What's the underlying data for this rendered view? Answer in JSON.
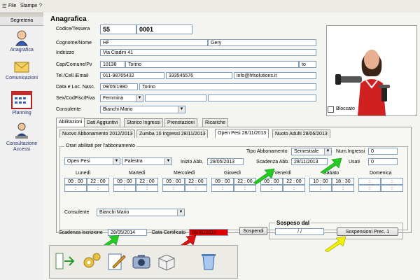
{
  "menu": {
    "file": "File",
    "stampe": "Stampe",
    "help": "?"
  },
  "sidebar": {
    "header": "Segreteria",
    "items": [
      {
        "label": "Anagrafica"
      },
      {
        "label": "Comunicazioni"
      },
      {
        "label": "Planning"
      },
      {
        "label": "Consultazione Accessi"
      }
    ]
  },
  "anagrafica": {
    "title": "Anagrafica",
    "codice_label": "Codice/Tessera",
    "codice": "55",
    "tessera": "0001",
    "cognome_label": "Cognome/Nome",
    "cognome": "HF",
    "nome": "Gery",
    "indirizzo_label": "Indirizzo",
    "indirizzo": "Via Ciadini 41",
    "cap_label": "Cap/Comune/Pv",
    "cap": "10138",
    "comune": "Torino",
    "pv": "to",
    "tel_label": "Tel./Cell./Email",
    "tel": "011-98765432",
    "cell": "333545576",
    "email": "info@hfsolutions.it",
    "nascita_label": "Data e Loc. Nasc.",
    "data_nascita": "09/05/1980",
    "loc_nascita": "Torino",
    "sesso_label": "Sex/CodFisc/Piva",
    "sesso": "Femmina",
    "consulente_label": "Consulente",
    "consulente": "Bianchi Mario",
    "bloccato_label": "Bloccato"
  },
  "tabs": [
    "Abilitazioni",
    "Dati Aggiuntivi",
    "Storico Ingressi",
    "Prenotazioni",
    "Ricariche"
  ],
  "subtabs": [
    "Nuovo Abbonamento 2012/2013",
    "Zumba 10 Ingressi 28/11/2013",
    "Open Pesi 28/11/2013",
    "Nuoto Adulti 28/06/2013"
  ],
  "abbonamento": {
    "group_title": "Orari abilitati per l'abbonamento",
    "nome": "Open Pesi",
    "area": "Palestra",
    "tipo_label": "Tipo Abbonamento",
    "tipo": "Semestrale",
    "num_ingressi_label": "Num.Ingressi",
    "num_ingressi": "0",
    "inizio_label": "Inizio Abb.",
    "inizio": "28/05/2013",
    "scadenza_label": "Scadenza Abb.",
    "scadenza": "28/11/2013",
    "usati_label": "Usati",
    "usati": "0",
    "consulente_label": "Consulente",
    "consulente": "Bianchi Mario"
  },
  "days": [
    {
      "name": "Lunedì",
      "from": "09 : 00",
      "to": "22 : 00"
    },
    {
      "name": "Martedì",
      "from": "09 : 00",
      "to": "22 : 00"
    },
    {
      "name": "Mercoledì",
      "from": "09 : 00",
      "to": "22 : 00"
    },
    {
      "name": "Giovedì",
      "from": "09 : 00",
      "to": "22 : 00"
    },
    {
      "name": "Venerdì",
      "from": "09 : 00",
      "to": "22 : 00"
    },
    {
      "name": "Sabato",
      "from": "10 : 00",
      "to": "18 : 30"
    },
    {
      "name": "Domenica",
      "from": ":",
      "to": ":"
    }
  ],
  "empty_time": ":",
  "bottom": {
    "scadenza_iscr_label": "Scadenza Iscrizione",
    "scadenza_iscr": "28/05/2014",
    "data_cert_label": "Data Certificato",
    "data_cert": "01/01/2012",
    "sospendi_button": "Sospendi",
    "sospeso_label": "Sospeso dal",
    "sospeso_date": "/ /",
    "sospensioni_button": "Sospensioni Prec. 1"
  },
  "toolbar_icons": [
    "exit-icon",
    "settings-icon",
    "edit-icon",
    "camera-icon",
    "box-icon",
    "delete-icon"
  ],
  "colors": {
    "arrow_green": "#22cc22",
    "arrow_red": "#e01010",
    "arrow_yellow": "#f0f000",
    "field_border": "#7f9db9",
    "red_field": "#e00000"
  }
}
